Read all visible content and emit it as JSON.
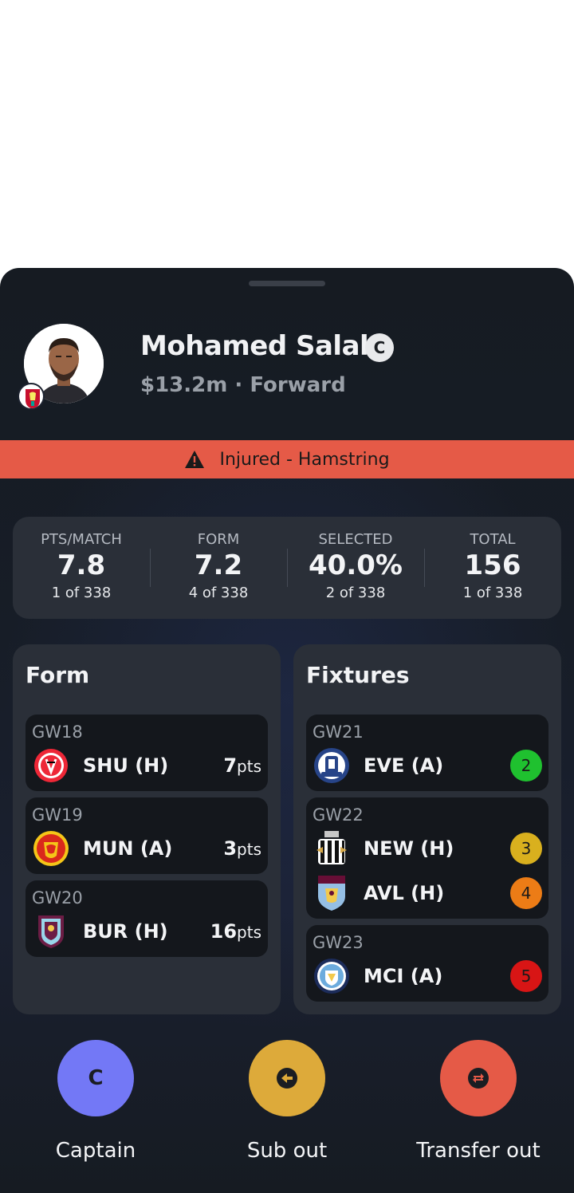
{
  "player": {
    "name": "Mohamed Salah",
    "captain_badge": "C",
    "price_position": "$13.2m · Forward",
    "team_badge_icon": "liverpool-crest"
  },
  "status": {
    "text": "Injured - Hamstring",
    "icon": "warning-icon",
    "color": "#e55a47"
  },
  "stats": [
    {
      "label": "PTS/MATCH",
      "value": "7.8",
      "rank": "1 of 338"
    },
    {
      "label": "FORM",
      "value": "7.2",
      "rank": "4 of 338"
    },
    {
      "label": "SELECTED",
      "value": "40.0%",
      "rank": "2 of 338"
    },
    {
      "label": "TOTAL",
      "value": "156",
      "rank": "1 of 338"
    }
  ],
  "form": {
    "title": "Form",
    "gameweeks": [
      {
        "gw": "GW18",
        "opponent": "SHU (H)",
        "pts": "7",
        "unit": "pts",
        "crest": "sheffield-united-crest"
      },
      {
        "gw": "GW19",
        "opponent": "MUN (A)",
        "pts": "3",
        "unit": "pts",
        "crest": "manchester-united-crest"
      },
      {
        "gw": "GW20",
        "opponent": "BUR (H)",
        "pts": "16",
        "unit": "pts",
        "crest": "burnley-crest"
      }
    ]
  },
  "fixtures": {
    "title": "Fixtures",
    "gameweeks": [
      {
        "gw": "GW21",
        "matches": [
          {
            "opponent": "EVE (A)",
            "fdr": "2",
            "color": "#1fc12f",
            "crest": "everton-crest"
          }
        ]
      },
      {
        "gw": "GW22",
        "matches": [
          {
            "opponent": "NEW (H)",
            "fdr": "3",
            "color": "#d9b01e",
            "crest": "newcastle-crest"
          },
          {
            "opponent": "AVL (H)",
            "fdr": "4",
            "color": "#ec7c16",
            "crest": "aston-villa-crest"
          }
        ]
      },
      {
        "gw": "GW23",
        "matches": [
          {
            "opponent": "MCI (A)",
            "fdr": "5",
            "color": "#d81515",
            "crest": "manchester-city-crest"
          }
        ]
      }
    ]
  },
  "actions": [
    {
      "label": "Captain",
      "glyph": "C",
      "color": "#7378f6",
      "icon": "captain-icon"
    },
    {
      "label": "Sub out",
      "color": "#ddaa3a",
      "icon": "arrow-left-icon"
    },
    {
      "label": "Transfer out",
      "color": "#e55a47",
      "icon": "transfer-icon"
    }
  ]
}
